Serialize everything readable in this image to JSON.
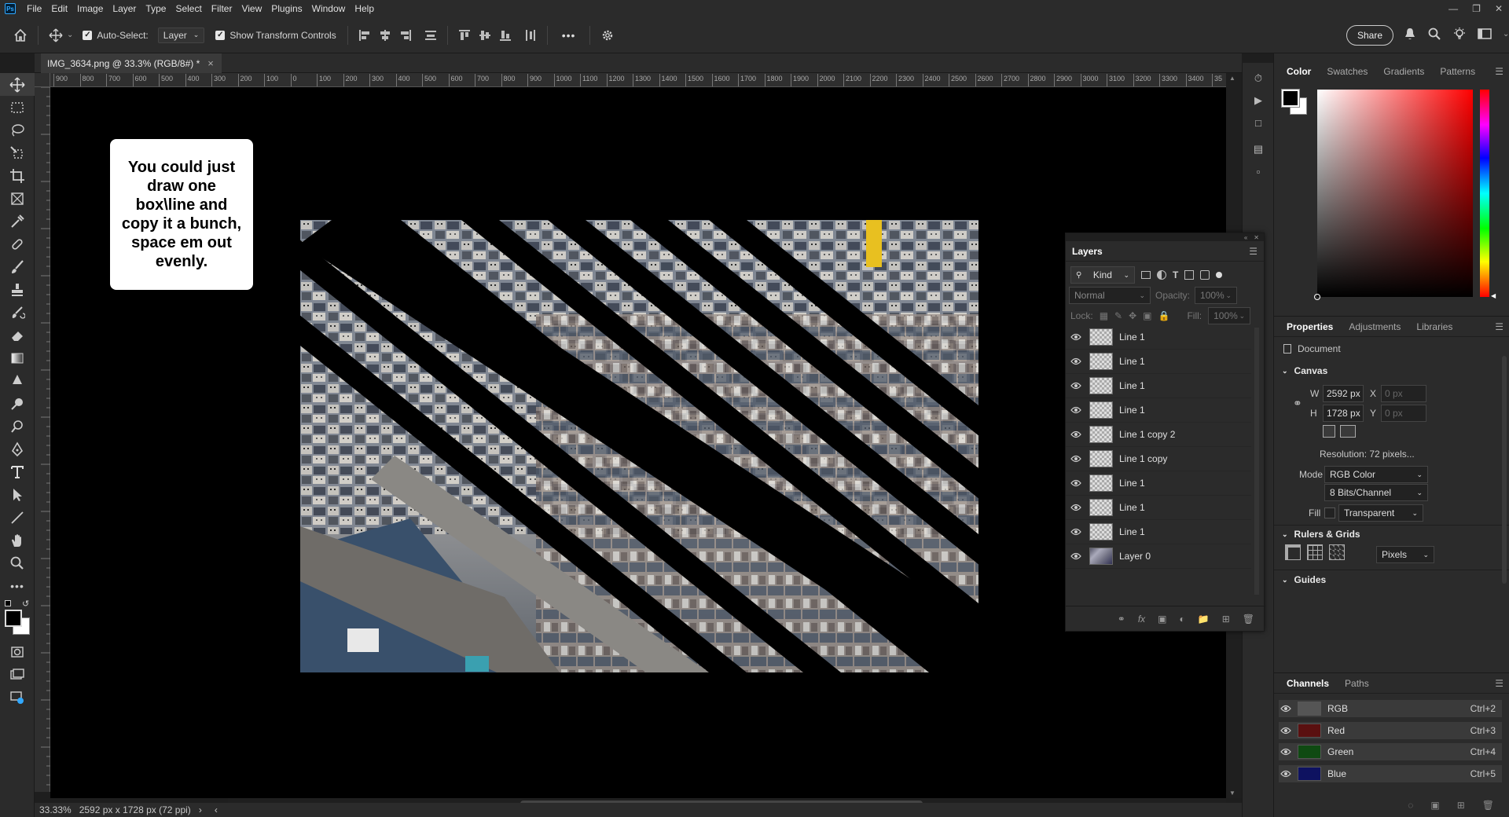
{
  "app": {
    "logo": "Ps"
  },
  "menu": [
    "File",
    "Edit",
    "Image",
    "Layer",
    "Type",
    "Select",
    "Filter",
    "View",
    "Plugins",
    "Window",
    "Help"
  ],
  "options": {
    "auto_select_label": "Auto-Select:",
    "auto_select_target": "Layer",
    "transform_label": "Show Transform Controls",
    "more": "•••",
    "share_label": "Share"
  },
  "doc": {
    "tab_title": "IMG_3634.png @ 33.3% (RGB/8#) *",
    "close": "×"
  },
  "ruler_ticks": [
    "900",
    "800",
    "700",
    "600",
    "500",
    "400",
    "300",
    "200",
    "100",
    "0",
    "100",
    "200",
    "300",
    "400",
    "500",
    "600",
    "700",
    "800",
    "900",
    "1000",
    "1100",
    "1200",
    "1300",
    "1400",
    "1500",
    "1600",
    "1700",
    "1800",
    "1900",
    "2000",
    "2100",
    "2200",
    "2300",
    "2400",
    "2500",
    "2600",
    "2700",
    "2800",
    "2900",
    "3000",
    "3100",
    "3200",
    "3300",
    "3400",
    "35"
  ],
  "annotation": "You could just draw one box\\line and copy it a bunch, space em out evenly.",
  "status": {
    "zoom": "33.33%",
    "info": "2592 px x 1728 px (72 ppi)",
    "arrow": "›"
  },
  "color_panel": {
    "tabs": [
      "Color",
      "Swatches",
      "Gradients",
      "Patterns"
    ],
    "fg": "#000000",
    "bg": "#ffffff"
  },
  "properties": {
    "tabs": [
      "Properties",
      "Adjustments",
      "Libraries"
    ],
    "doc_label": "Document",
    "canvas_title": "Canvas",
    "w_label": "W",
    "w_value": "2592 px",
    "h_label": "H",
    "h_value": "1728 px",
    "x_label": "X",
    "x_value": "0 px",
    "y_label": "Y",
    "y_value": "0 px",
    "resolution": "Resolution: 72 pixels...",
    "mode_label": "Mode",
    "mode_value": "RGB Color",
    "bits_value": "8 Bits/Channel",
    "fill_label": "Fill",
    "fill_value": "Transparent",
    "rulers_title": "Rulers & Grids",
    "units_value": "Pixels",
    "guides_title": "Guides"
  },
  "layers": {
    "title": "Layers",
    "filter_kind": "Kind",
    "blend_mode": "Normal",
    "opacity_label": "Opacity:",
    "opacity_value": "100%",
    "lock_label": "Lock:",
    "fill_label": "Fill:",
    "fill_value": "100%",
    "items": [
      {
        "name": "Line 1"
      },
      {
        "name": "Line 1"
      },
      {
        "name": "Line 1"
      },
      {
        "name": "Line 1"
      },
      {
        "name": "Line 1 copy 2"
      },
      {
        "name": "Line 1 copy"
      },
      {
        "name": "Line 1"
      },
      {
        "name": "Line 1"
      },
      {
        "name": "Line 1"
      },
      {
        "name": "Layer 0"
      }
    ]
  },
  "channels": {
    "tabs": [
      "Channels",
      "Paths"
    ],
    "items": [
      {
        "name": "RGB",
        "shortcut": "Ctrl+2",
        "color": "#555555"
      },
      {
        "name": "Red",
        "shortcut": "Ctrl+3",
        "color": "#5a1010"
      },
      {
        "name": "Green",
        "shortcut": "Ctrl+4",
        "color": "#0f4a12"
      },
      {
        "name": "Blue",
        "shortcut": "Ctrl+5",
        "color": "#0e1260"
      }
    ]
  }
}
